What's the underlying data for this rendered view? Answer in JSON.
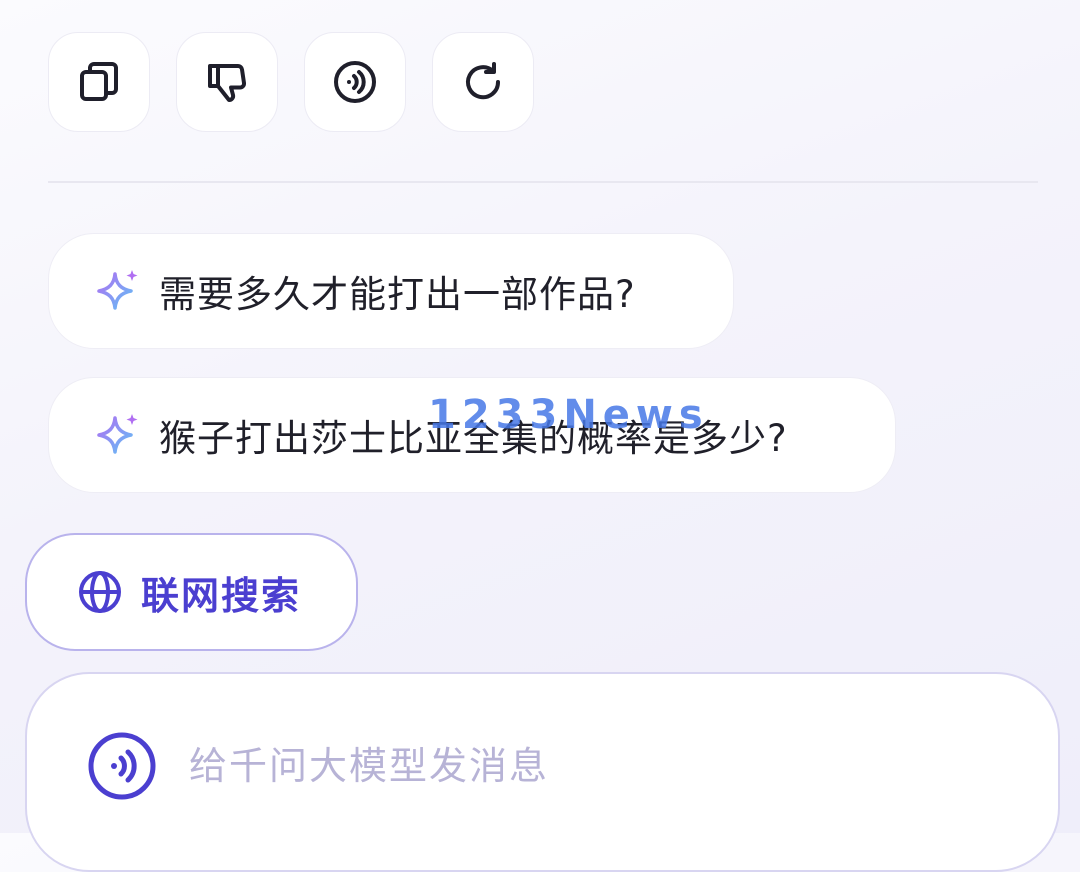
{
  "toolbar": {
    "buttons": [
      {
        "icon": "copy-icon"
      },
      {
        "icon": "thumbs-down-icon"
      },
      {
        "icon": "speaker-icon"
      },
      {
        "icon": "refresh-icon"
      }
    ]
  },
  "suggestions": [
    {
      "text": "需要多久才能打出一部作品?",
      "icon": "sparkle-icon"
    },
    {
      "text": "猴子打出莎士比亚全集的概率是多少?",
      "icon": "sparkle-icon"
    }
  ],
  "web_search": {
    "label": "联网搜索",
    "icon": "globe-icon"
  },
  "input": {
    "placeholder": "给千问大模型发消息",
    "value": "",
    "voice_icon": "voice-wave-icon"
  },
  "watermark": "1233News",
  "colors": {
    "accent": "#4b3fd0",
    "accent_border": "#b9b3ec",
    "placeholder": "#b7b3d6",
    "icon_dark": "#1f1f2b",
    "sparkle_purple": "#a66cf0",
    "sparkle_blue": "#6fb6f5"
  }
}
